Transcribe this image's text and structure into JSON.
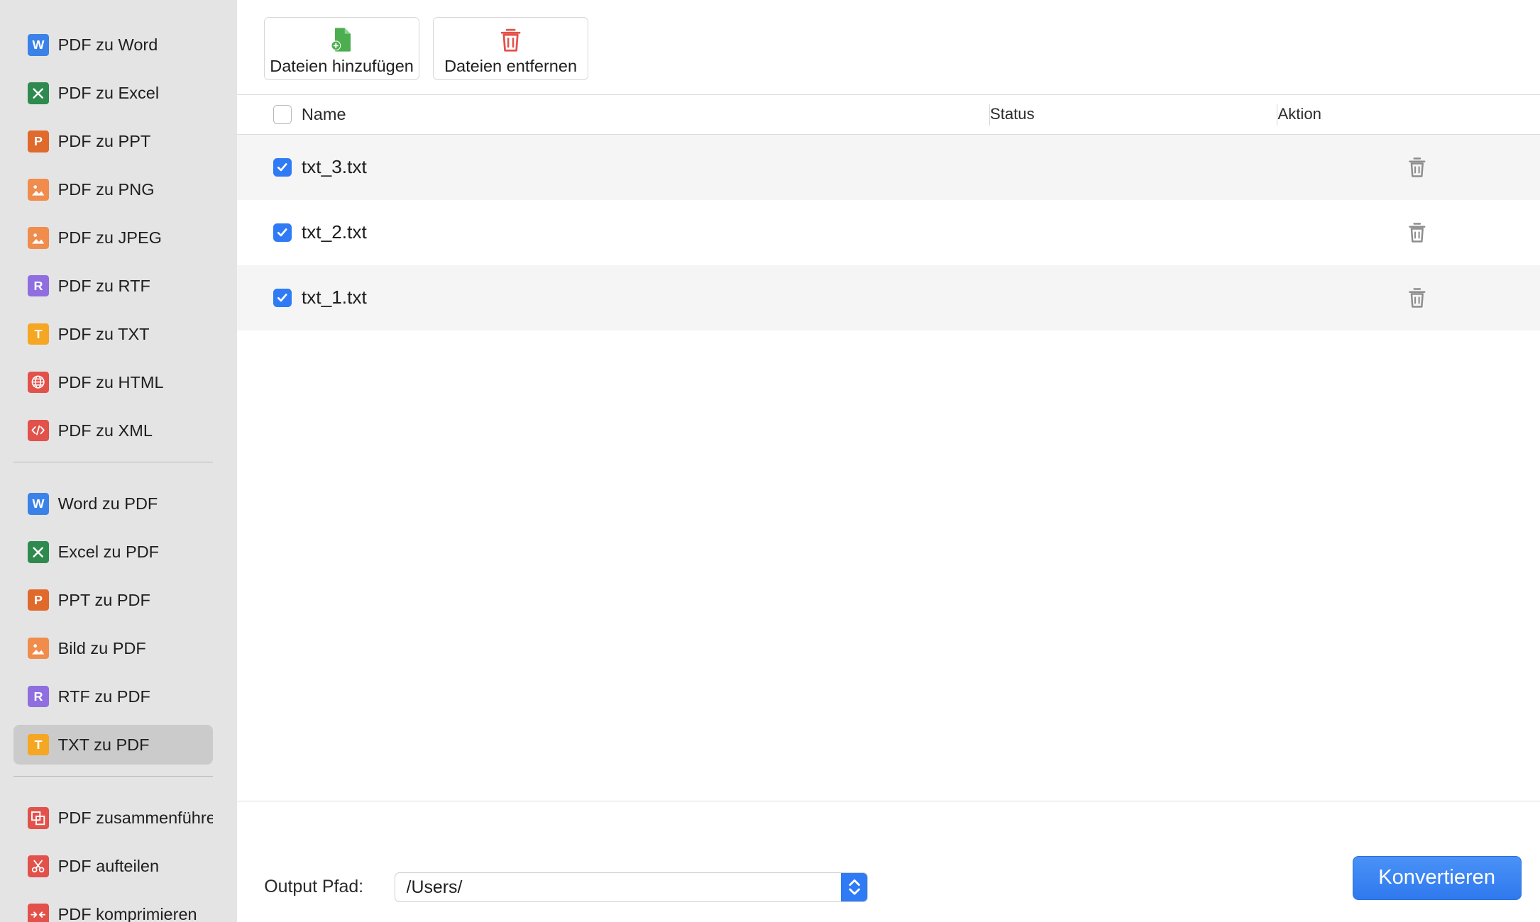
{
  "sidebar": {
    "groups": [
      [
        {
          "label": "PDF zu Word",
          "icon": "word-icon",
          "color": "#3b82e8",
          "glyph": "W"
        },
        {
          "label": "PDF zu Excel",
          "icon": "excel-icon",
          "color": "#2f8a4f",
          "glyph": "X"
        },
        {
          "label": "PDF zu PPT",
          "icon": "powerpoint-icon",
          "color": "#e06a2c",
          "glyph": "P"
        },
        {
          "label": "PDF zu PNG",
          "icon": "image-icon",
          "color": "#f08c4c",
          "glyph": ""
        },
        {
          "label": "PDF zu JPEG",
          "icon": "image-icon",
          "color": "#f08c4c",
          "glyph": ""
        },
        {
          "label": "PDF zu RTF",
          "icon": "rtf-icon",
          "color": "#8f6ee0",
          "glyph": "R"
        },
        {
          "label": "PDF zu TXT",
          "icon": "txt-icon",
          "color": "#f5a623",
          "glyph": "T"
        },
        {
          "label": "PDF zu HTML",
          "icon": "globe-icon",
          "color": "#e2514a",
          "glyph": ""
        },
        {
          "label": "PDF zu XML",
          "icon": "code-icon",
          "color": "#e2514a",
          "glyph": ""
        }
      ],
      [
        {
          "label": "Word zu PDF",
          "icon": "word-icon",
          "color": "#3b82e8",
          "glyph": "W"
        },
        {
          "label": "Excel zu PDF",
          "icon": "excel-icon",
          "color": "#2f8a4f",
          "glyph": "X"
        },
        {
          "label": "PPT zu PDF",
          "icon": "powerpoint-icon",
          "color": "#e06a2c",
          "glyph": "P"
        },
        {
          "label": "Bild zu PDF",
          "icon": "image-icon",
          "color": "#f08c4c",
          "glyph": ""
        },
        {
          "label": "RTF zu PDF",
          "icon": "rtf-icon",
          "color": "#8f6ee0",
          "glyph": "R"
        },
        {
          "label": "TXT zu PDF",
          "icon": "txt-icon",
          "color": "#f5a623",
          "glyph": "T",
          "active": true
        }
      ],
      [
        {
          "label": "PDF zusammenführen",
          "icon": "merge-icon",
          "color": "#e2514a",
          "glyph": ""
        },
        {
          "label": "PDF aufteilen",
          "icon": "scissors-icon",
          "color": "#e2514a",
          "glyph": ""
        },
        {
          "label": "PDF komprimieren",
          "icon": "compress-icon",
          "color": "#e2514a",
          "glyph": ""
        }
      ]
    ]
  },
  "toolbar": {
    "add_label": "Dateien hinzufügen",
    "remove_label": "Dateien entfernen",
    "add_color": "#4cae4f",
    "remove_color": "#e2514a"
  },
  "table": {
    "columns": {
      "name": "Name",
      "status": "Status",
      "action": "Aktion"
    },
    "rows": [
      {
        "name": "txt_3.txt",
        "checked": true,
        "status": ""
      },
      {
        "name": "txt_2.txt",
        "checked": true,
        "status": ""
      },
      {
        "name": "txt_1.txt",
        "checked": true,
        "status": ""
      }
    ]
  },
  "footer": {
    "output_label": "Output Pfad:",
    "output_value": "/Users/",
    "convert_label": "Konvertieren"
  },
  "colors": {
    "accent": "#2f7bf5"
  }
}
